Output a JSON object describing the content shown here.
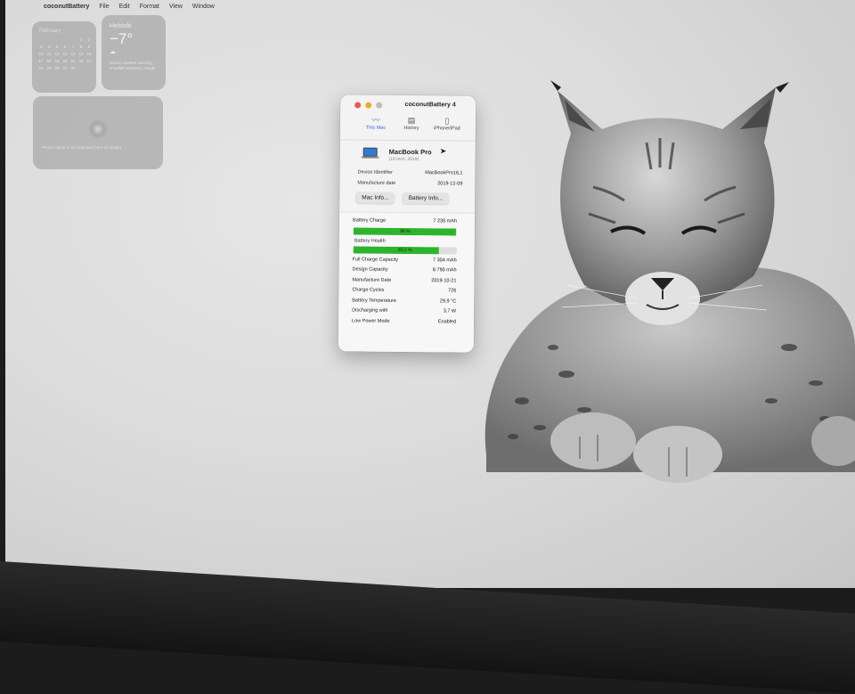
{
  "menubar": {
    "apple": "",
    "app_name": "coconutBattery",
    "items": [
      "File",
      "Edit",
      "Format",
      "View",
      "Window"
    ]
  },
  "widgets": {
    "calendar": {
      "month": "February",
      "days": [
        "",
        "",
        "",
        "",
        "",
        "1",
        "2",
        "3",
        "4",
        "5",
        "6",
        "7",
        "8",
        "9",
        "10",
        "11",
        "12",
        "13",
        "14",
        "15",
        "16",
        "17",
        "18",
        "19",
        "20",
        "21",
        "22",
        "23",
        "24",
        "25",
        "26",
        "27",
        "28"
      ]
    },
    "weather": {
      "city": "Helsinki",
      "temperature": "−7°",
      "condition_icon": "cloud-icon",
      "description": "Snowy weather warning, snowfall expected, cloudy"
    },
    "photos": {
      "message": "Photos about to be displayed here for widget"
    }
  },
  "window": {
    "title": "coconutBattery 4",
    "tabs": [
      {
        "label": "This Mac",
        "icon": "battery-waves-icon",
        "active": true
      },
      {
        "label": "History",
        "icon": "archive-box-icon",
        "active": false
      },
      {
        "label": "iPhone/iPad",
        "icon": "phone-icon",
        "active": false
      }
    ],
    "device": {
      "name": "MacBook Pro",
      "subtitle": "(16-inch, 2019)",
      "identifier_label": "Device Identifier",
      "identifier_value": "MacBookPro16,1",
      "manufacture_label": "Manufacture date",
      "manufacture_value": "2019-12-09"
    },
    "buttons": {
      "mac_info": "Mac Info...",
      "battery_info": "Battery Info..."
    },
    "battery": {
      "charge_label": "Battery Charge",
      "charge_value": "7 230 mAh",
      "charge_percent_text": "99 %",
      "charge_fraction": 0.99,
      "health_label": "Battery Health",
      "health_percent_text": "83,1 %",
      "health_fraction": 0.831,
      "bar_color": "#2bb52b",
      "rows": [
        {
          "label": "Full Charge Capacity",
          "value": "7 304 mAh"
        },
        {
          "label": "Design Capacity",
          "value": "8 790 mAh"
        },
        {
          "label": "Manufacture Date",
          "value": "2019-10-21"
        },
        {
          "label": "Charge Cycles",
          "value": "726"
        },
        {
          "label": "Battery Temperature",
          "value": "29,9 °C"
        },
        {
          "label": "Discharging with",
          "value": "3,7 W"
        },
        {
          "label": "Low Power Mode",
          "value": "Enabled"
        }
      ]
    }
  },
  "wallpaper": {
    "subject": "lynx"
  }
}
